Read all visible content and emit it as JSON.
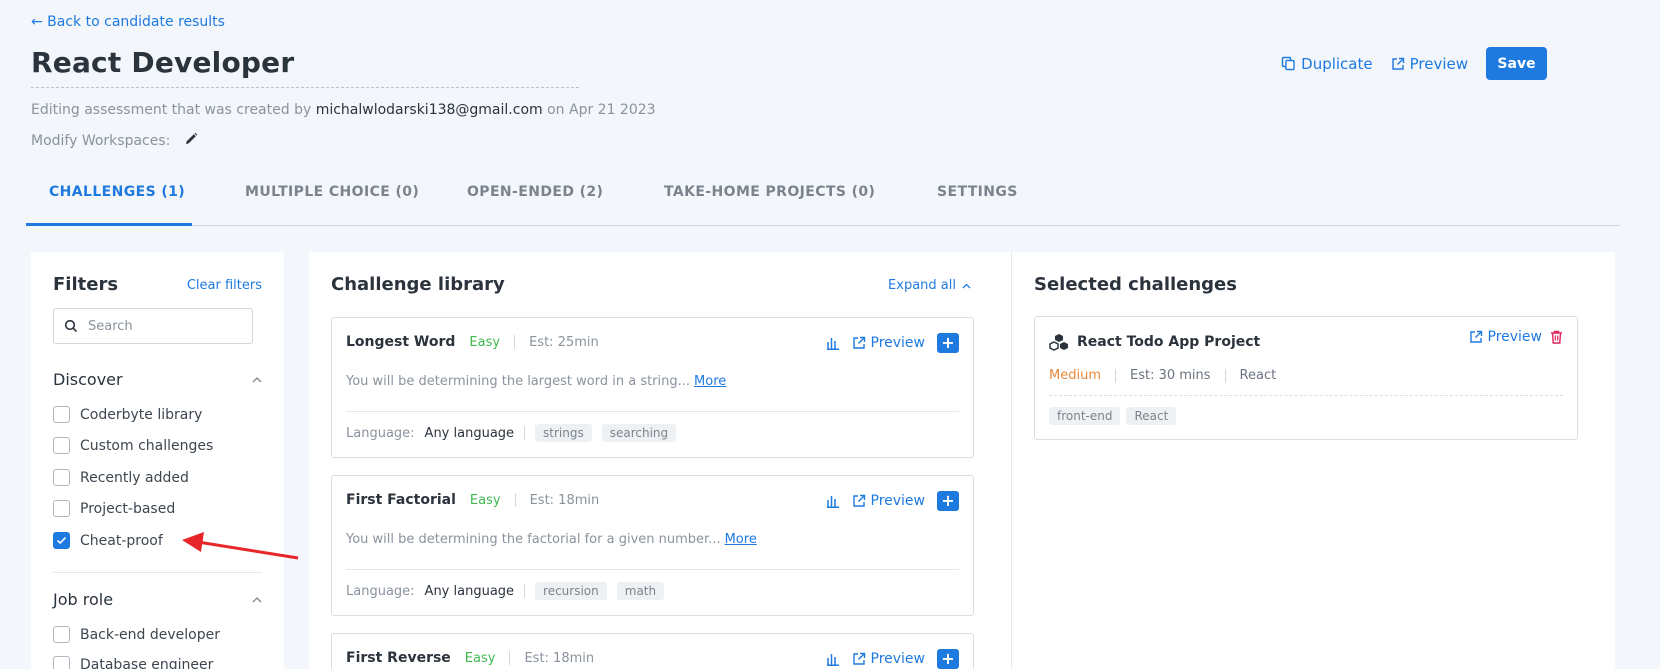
{
  "header": {
    "back_label": "← Back to candidate results",
    "title": "React Developer",
    "meta_prefix": "Editing assessment that was created by",
    "meta_email": "michalwlodarski138@gmail.com",
    "meta_suffix": "on Apr 21 2023",
    "workspaces_label": "Modify Workspaces:",
    "duplicate_label": "Duplicate",
    "preview_label": "Preview",
    "save_label": "Save"
  },
  "tabs": [
    {
      "label": "CHALLENGES (1)",
      "active": true
    },
    {
      "label": "MULTIPLE CHOICE (0)",
      "active": false
    },
    {
      "label": "OPEN-ENDED (2)",
      "active": false
    },
    {
      "label": "TAKE-HOME PROJECTS (0)",
      "active": false
    },
    {
      "label": "SETTINGS",
      "active": false
    }
  ],
  "filters": {
    "title": "Filters",
    "clear_label": "Clear filters",
    "search_placeholder": "Search",
    "discover": {
      "title": "Discover",
      "items": [
        {
          "label": "Coderbyte library",
          "checked": false
        },
        {
          "label": "Custom challenges",
          "checked": false
        },
        {
          "label": "Recently added",
          "checked": false
        },
        {
          "label": "Project-based",
          "checked": false
        },
        {
          "label": "Cheat-proof",
          "checked": true
        }
      ]
    },
    "job_role": {
      "title": "Job role",
      "items": [
        {
          "label": "Back-end developer",
          "checked": false
        },
        {
          "label": "Database engineer",
          "checked": false
        }
      ]
    }
  },
  "library": {
    "title": "Challenge library",
    "expand_label": "Expand all",
    "preview_label": "Preview",
    "more_label": "More",
    "language_label": "Language:",
    "cards": [
      {
        "name": "Longest Word",
        "difficulty": "Easy",
        "est": "Est: 25min",
        "desc": "You will be determining the largest word in a string...",
        "language": "Any language",
        "tags": [
          "strings",
          "searching"
        ]
      },
      {
        "name": "First Factorial",
        "difficulty": "Easy",
        "est": "Est: 18min",
        "desc": "You will be determining the factorial for a given number...",
        "language": "Any language",
        "tags": [
          "recursion",
          "math"
        ]
      },
      {
        "name": "First Reverse",
        "difficulty": "Easy",
        "est": "Est: 18min"
      }
    ]
  },
  "selected": {
    "title": "Selected challenges",
    "card": {
      "name": "React Todo App Project",
      "preview_label": "Preview",
      "difficulty": "Medium",
      "est": "Est: 30 mins",
      "language": "React",
      "tags": [
        "front-end",
        "React"
      ]
    }
  },
  "colors": {
    "accent": "#1f7ae0",
    "easy": "#3fb950",
    "medium": "#e8893a",
    "delete": "#e0245e",
    "annotation_arrow": "#e8262a"
  }
}
